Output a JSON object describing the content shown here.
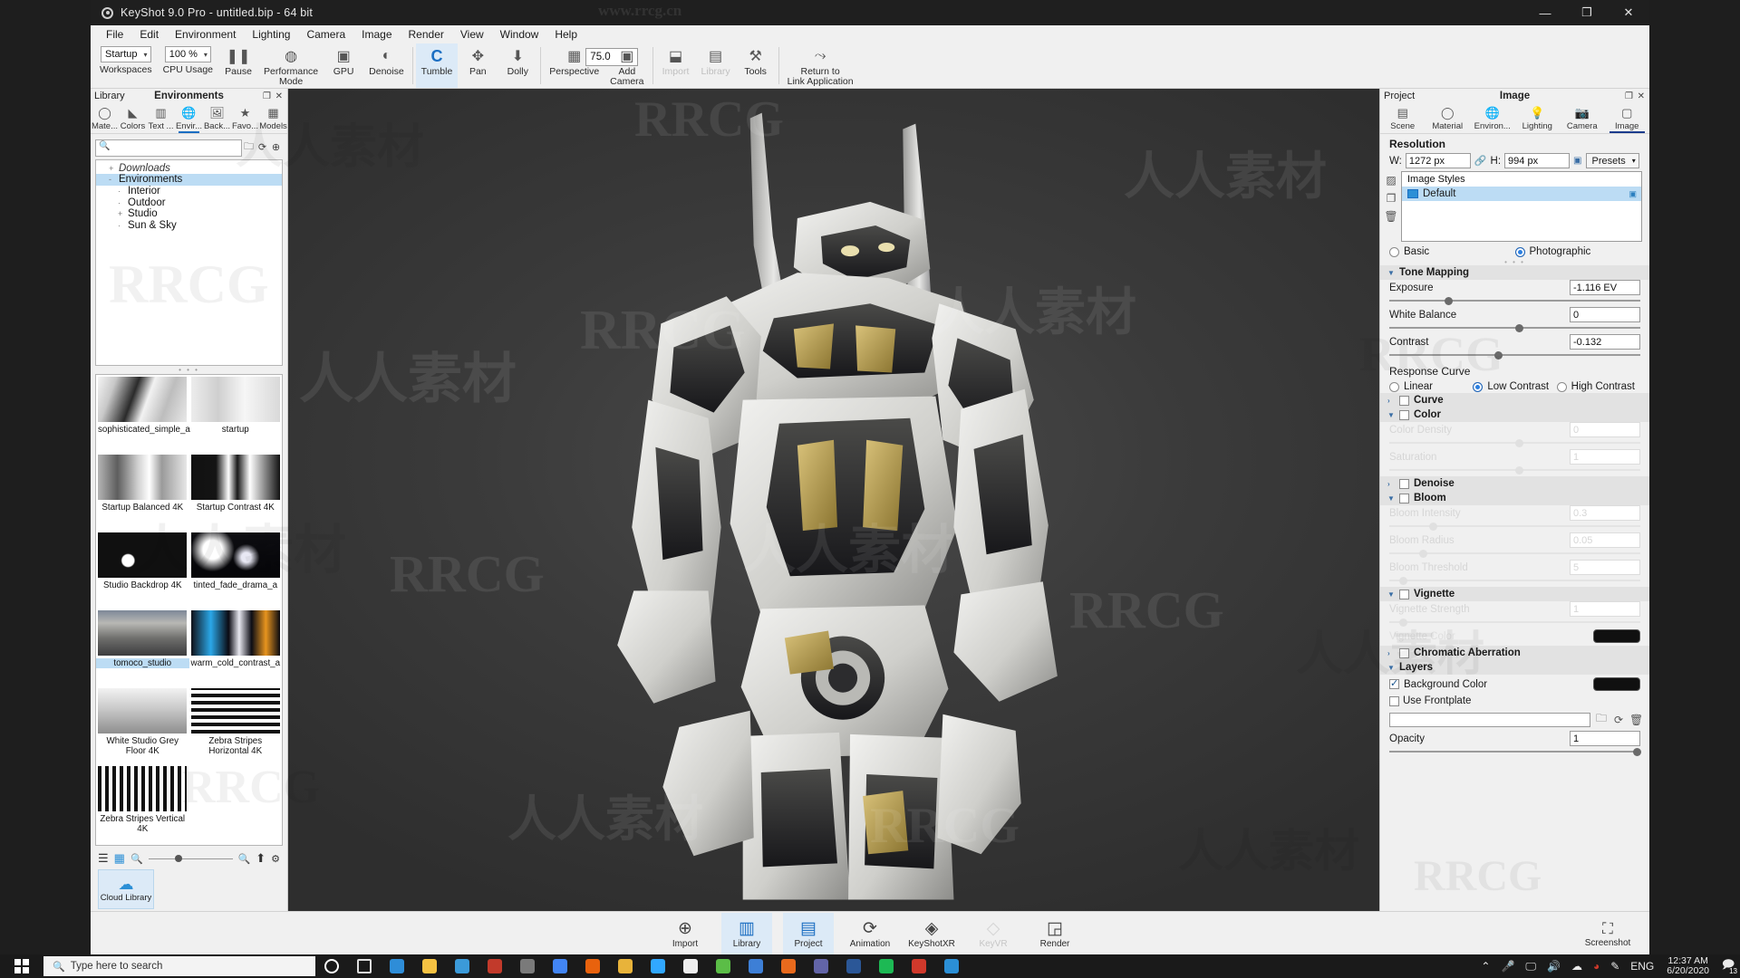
{
  "window": {
    "title": "KeyShot 9.0 Pro  - untitled.bip  - 64 bit",
    "minimize": "—",
    "maximize": "❐",
    "close": "✕"
  },
  "menubar": [
    "File",
    "Edit",
    "Environment",
    "Lighting",
    "Camera",
    "Image",
    "Render",
    "View",
    "Window",
    "Help"
  ],
  "toolbar": {
    "workspaces": {
      "label": "Workspaces",
      "value": "Startup"
    },
    "cpu_usage": {
      "label": "CPU Usage",
      "value": "100 %"
    },
    "items": [
      {
        "label": "Pause",
        "icon": "pause-icon",
        "state": "normal"
      },
      {
        "label": "Performance\nMode",
        "icon": "performance-icon",
        "state": "normal"
      },
      {
        "label": "GPU",
        "icon": "gpu-icon",
        "state": "normal"
      },
      {
        "label": "Denoise",
        "icon": "denoise-icon",
        "state": "normal"
      },
      {
        "label": "Tumble",
        "icon": "tumble-icon",
        "state": "selected"
      },
      {
        "label": "Pan",
        "icon": "pan-icon",
        "state": "normal"
      },
      {
        "label": "Dolly",
        "icon": "dolly-icon",
        "state": "normal"
      },
      {
        "label": "Perspective",
        "icon": "perspective-icon",
        "state": "normal",
        "value": "75.0"
      },
      {
        "label": "Add\nCamera",
        "icon": "add-camera-icon",
        "state": "normal"
      },
      {
        "label": "Import",
        "icon": "import-icon",
        "state": "disabled"
      },
      {
        "label": "Library",
        "icon": "library-icon",
        "state": "disabled"
      },
      {
        "label": "Tools",
        "icon": "tools-icon",
        "state": "normal"
      },
      {
        "label": "Return to\nLink Application",
        "icon": "link-app-icon",
        "state": "normal"
      }
    ]
  },
  "library": {
    "header_left": "Library",
    "header_center": "Environments",
    "float_icon": "float-panel-icon",
    "close_icon": "close-icon",
    "tabs": [
      {
        "label": "Mate...",
        "icon": "material-icon",
        "active": false
      },
      {
        "label": "Colors",
        "icon": "colors-icon",
        "active": false
      },
      {
        "label": "Text ...",
        "icon": "texture-icon",
        "active": false
      },
      {
        "label": "Envir...",
        "icon": "environment-icon",
        "active": true
      },
      {
        "label": "Back...",
        "icon": "backplate-icon",
        "active": false
      },
      {
        "label": "Favo...",
        "icon": "favorites-icon",
        "active": false
      },
      {
        "label": "Models",
        "icon": "models-icon",
        "active": false
      }
    ],
    "search": {
      "placeholder": "",
      "value": "",
      "icon": "search-icon"
    },
    "search_buttons": [
      "folder-icon",
      "refresh-icon",
      "sync-icon"
    ],
    "tree": [
      {
        "label": "Downloads",
        "indent": 1,
        "twisty": "+",
        "selected": false,
        "italic": true
      },
      {
        "label": "Environments",
        "indent": 1,
        "twisty": "-",
        "selected": true,
        "italic": false
      },
      {
        "label": "Interior",
        "indent": 2,
        "twisty": "",
        "selected": false,
        "italic": false
      },
      {
        "label": "Outdoor",
        "indent": 2,
        "twisty": "",
        "selected": false,
        "italic": false
      },
      {
        "label": "Studio",
        "indent": 2,
        "twisty": "+",
        "selected": false,
        "italic": false
      },
      {
        "label": "Sun & Sky",
        "indent": 2,
        "twisty": "",
        "selected": false,
        "italic": false
      }
    ],
    "thumbnails": [
      {
        "caption": "sophisticated_simple_a",
        "selected": false,
        "style": "th-sophisticated"
      },
      {
        "caption": "startup",
        "selected": false,
        "style": "th-startup"
      },
      {
        "caption": "Startup Balanced 4K",
        "selected": false,
        "style": "th-balanced"
      },
      {
        "caption": "Startup Contrast 4K",
        "selected": false,
        "style": "th-contrast"
      },
      {
        "caption": "Studio Backdrop 4K",
        "selected": false,
        "style": "th-backdrop"
      },
      {
        "caption": "tinted_fade_drama_a",
        "selected": false,
        "style": "th-tinted"
      },
      {
        "caption": "tomoco_studio",
        "selected": true,
        "style": "th-tomoco"
      },
      {
        "caption": "warm_cold_contrast_a",
        "selected": false,
        "style": "th-warm"
      },
      {
        "caption": "White Studio Grey Floor 4K",
        "selected": false,
        "style": "th-white"
      },
      {
        "caption": "Zebra Stripes Horizontal 4K",
        "selected": false,
        "style": "th-zebrah"
      },
      {
        "caption": "Zebra Stripes Vertical 4K",
        "selected": false,
        "style": "th-zebrav"
      }
    ],
    "bottom_icons": [
      "list-view-icon",
      "grid-view-icon",
      "zoom-out-icon",
      "zoom-in-icon",
      "upload-icon",
      "settings-icon"
    ],
    "cloud_library": {
      "label": "Cloud Library",
      "icon": "cloud-icon"
    }
  },
  "project": {
    "header_left": "Project",
    "header_center": "Image",
    "float_icon": "float-panel-icon",
    "close_icon": "close-icon",
    "tabs": [
      {
        "label": "Scene",
        "icon": "scene-icon",
        "active": false
      },
      {
        "label": "Material",
        "icon": "material-icon",
        "active": false
      },
      {
        "label": "Environ...",
        "icon": "environment-icon",
        "active": false
      },
      {
        "label": "Lighting",
        "icon": "lighting-icon",
        "active": false
      },
      {
        "label": "Camera",
        "icon": "camera-icon",
        "active": false
      },
      {
        "label": "Image",
        "icon": "image-icon",
        "active": true
      }
    ],
    "resolution": {
      "title": "Resolution",
      "w_label": "W:",
      "w_value": "1272 px",
      "link_icon": "link-icon",
      "h_label": "H:",
      "h_value": "994 px",
      "lock_icon": "lock-icon",
      "presets_label": "Presets"
    },
    "image_styles": {
      "header": "Image Styles",
      "items": [
        {
          "label": "Default",
          "selected": true
        }
      ],
      "side_icons": [
        "add-style-icon",
        "duplicate-style-icon",
        "delete-style-icon"
      ]
    },
    "mode": {
      "basic": "Basic",
      "photographic": "Photographic",
      "selected": "Photographic"
    },
    "tone_mapping": {
      "title": "Tone Mapping",
      "exposure": {
        "label": "Exposure",
        "value": "-1.116 EV",
        "knob_pct": 22
      },
      "white_balance": {
        "label": "White Balance",
        "value": "0",
        "knob_pct": 50
      },
      "contrast": {
        "label": "Contrast",
        "value": "-0.132",
        "knob_pct": 42
      }
    },
    "response_curve": {
      "label": "Response Curve",
      "options": [
        "Linear",
        "Low Contrast",
        "High Contrast"
      ],
      "selected": "Low Contrast"
    },
    "groups": [
      {
        "name": "Curve",
        "checked": false,
        "expanded": false,
        "disabled": false
      },
      {
        "name": "Color",
        "checked": false,
        "expanded": true,
        "disabled": false
      },
      {
        "name": "Denoise",
        "checked": false,
        "expanded": false,
        "disabled": false
      },
      {
        "name": "Bloom",
        "checked": false,
        "expanded": true,
        "disabled": false
      },
      {
        "name": "Vignette",
        "checked": false,
        "expanded": true,
        "disabled": false
      },
      {
        "name": "Chromatic Aberration",
        "checked": false,
        "expanded": false,
        "disabled": false
      },
      {
        "name": "Layers",
        "checked": null,
        "expanded": true,
        "disabled": false
      }
    ],
    "color_sliders": [
      {
        "label": "Color Density",
        "value": "0",
        "knob_pct": 50,
        "disabled": true
      },
      {
        "label": "Saturation",
        "value": "1",
        "knob_pct": 50,
        "disabled": true
      }
    ],
    "bloom_sliders": [
      {
        "label": "Bloom Intensity",
        "value": "0.3",
        "knob_pct": 16,
        "disabled": true
      },
      {
        "label": "Bloom Radius",
        "value": "0.05",
        "knob_pct": 12,
        "disabled": true
      },
      {
        "label": "Bloom Threshold",
        "value": "5",
        "knob_pct": 4,
        "disabled": true
      }
    ],
    "vignette_sliders": [
      {
        "label": "Vignette Strength",
        "value": "1",
        "knob_pct": 4,
        "disabled": true
      }
    ],
    "vignette_color": {
      "label": "Vignette Color",
      "color": "#101010",
      "disabled": true
    },
    "layers": {
      "background_color": {
        "label": "Background Color",
        "checked": true,
        "color": "#101010"
      },
      "use_frontplate": {
        "label": "Use Frontplate",
        "checked": false
      },
      "path_value": "",
      "path_icons": [
        "open-folder-icon",
        "reload-icon",
        "trash-icon"
      ],
      "opacity": {
        "label": "Opacity",
        "value": "1",
        "knob_pct": 97
      }
    }
  },
  "dock": {
    "items": [
      {
        "label": "Import",
        "icon": "import-icon",
        "state": "normal"
      },
      {
        "label": "Library",
        "icon": "library-icon",
        "state": "active"
      },
      {
        "label": "Project",
        "icon": "project-icon",
        "state": "active"
      },
      {
        "label": "Animation",
        "icon": "animation-icon",
        "state": "normal"
      },
      {
        "label": "KeyShotXR",
        "icon": "keyshotxr-icon",
        "state": "normal"
      },
      {
        "label": "KeyVR",
        "icon": "keyvr-icon",
        "state": "disabled"
      },
      {
        "label": "Render",
        "icon": "render-icon",
        "state": "normal"
      }
    ],
    "screenshot": {
      "label": "Screenshot",
      "icon": "screenshot-icon"
    }
  },
  "taskbar": {
    "start_icon": "windows-start-icon",
    "search_placeholder": "Type here to search",
    "search_icon": "search-icon",
    "pinned": [
      {
        "name": "cortana-icon",
        "color": "#ffffff"
      },
      {
        "name": "task-view-icon",
        "color": "#dddddd"
      },
      {
        "name": "edge-icon",
        "color": "#2e8dd8"
      },
      {
        "name": "file-explorer-icon",
        "color": "#f5c242"
      },
      {
        "name": "store-icon",
        "color": "#3b9ad9"
      },
      {
        "name": "mail-icon",
        "color": "#c23a2b"
      },
      {
        "name": "video-icon",
        "color": "#7a7a7a"
      },
      {
        "name": "chrome-icon",
        "color": "#4285f4"
      },
      {
        "name": "search-app-icon",
        "color": "#e8620d"
      },
      {
        "name": "folder-icon",
        "color": "#e8b33a"
      },
      {
        "name": "photoshop-icon",
        "color": "#31a8ff"
      },
      {
        "name": "keyshot-icon",
        "color": "#eeeeee"
      },
      {
        "name": "plant-icon",
        "color": "#5bbd47"
      },
      {
        "name": "blue-app-icon",
        "color": "#3d7fd6"
      },
      {
        "name": "firefox-icon",
        "color": "#e86a1d"
      },
      {
        "name": "teams-icon",
        "color": "#6264a7"
      },
      {
        "name": "word-icon",
        "color": "#2b5797"
      },
      {
        "name": "spotify-icon",
        "color": "#1db954"
      },
      {
        "name": "red-app-icon",
        "color": "#d0392b"
      },
      {
        "name": "keyshot-app-icon",
        "color": "#2b8fd6"
      }
    ],
    "tray": {
      "chevron": "show-hidden-icons",
      "icons": [
        "microphone-icon",
        "display-icon",
        "volume-icon",
        "onedrive-icon",
        "security-icon",
        "pen-icon"
      ],
      "language": "ENG",
      "time": "12:37 AM",
      "date": "6/20/2020",
      "notifications_icon": "action-center-icon",
      "notifications_count": "13"
    }
  },
  "watermarks": {
    "site": "www.rrcg.cn",
    "brand": "RRCG",
    "cn": "人人素材"
  }
}
